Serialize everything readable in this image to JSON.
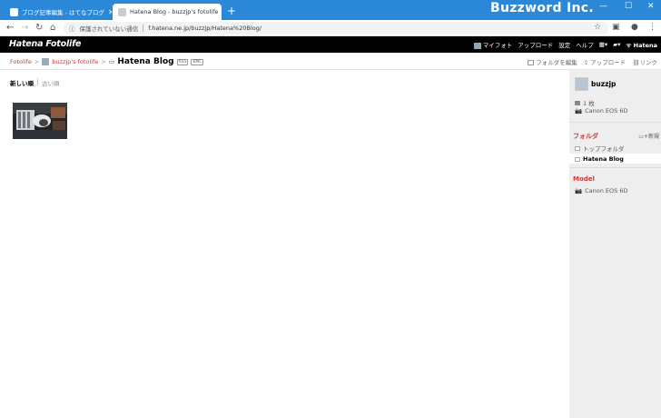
{
  "tabs": [
    {
      "label": "ブログ記事編集 - はてなブログ"
    },
    {
      "label": "Hatena Blog - buzzjp's fotolife"
    }
  ],
  "brand": "Buzzword Inc.",
  "address": {
    "security": "保護されていない通信",
    "url": "f.hatena.ne.jp/buzzjp/Hatena%20Blog/"
  },
  "header": {
    "logo": "Hatena Fotolife",
    "nav": [
      "マイフォト",
      "アップロード",
      "設定",
      "ヘルプ"
    ],
    "hatena": "Hatena"
  },
  "breadcrumb": {
    "root": "Fotolife",
    "user": "buzzjp's fotolife",
    "current": "Hatena Blog",
    "rss": "RSS",
    "kml": "KML"
  },
  "actions": {
    "edit_folder": "フォルダを編集",
    "upload": "アップロード",
    "link": "リンク"
  },
  "sort": {
    "newest": "新しい順",
    "oldest": "古い順"
  },
  "sidebar": {
    "username": "buzzjp",
    "count": "1 枚",
    "camera": "Canon EOS 6D",
    "folder_heading": "フォルダ",
    "new_label": "新規",
    "folders": [
      "トップフォルダ",
      "Hatena Blog"
    ],
    "model_heading": "Model",
    "model": "Canon EOS 6D"
  },
  "colors": {
    "titlebar": "#2b88d8",
    "accent": "#dd3333",
    "header": "#000000"
  }
}
